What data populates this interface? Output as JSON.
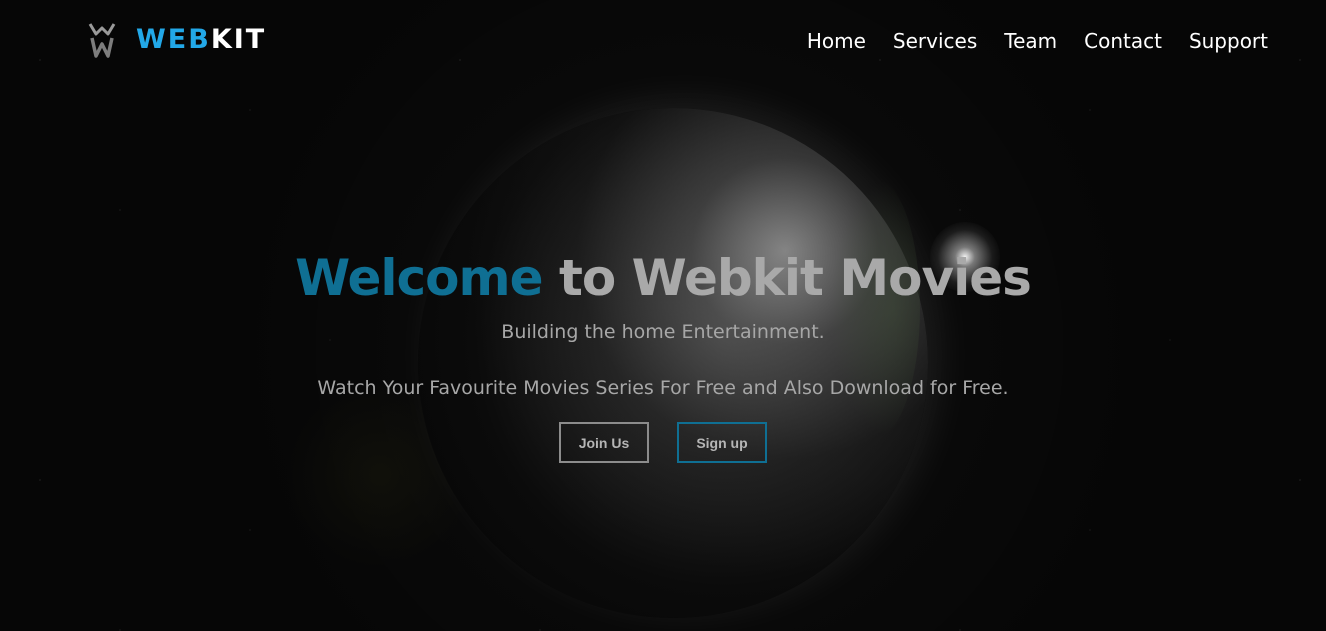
{
  "brand": {
    "part1": "WEB",
    "part2": "KIT",
    "accent_color": "#22a8e8",
    "logo_icon": "webkit-logo-icon"
  },
  "nav": {
    "items": [
      {
        "label": "Home"
      },
      {
        "label": "Services"
      },
      {
        "label": "Team"
      },
      {
        "label": "Contact"
      },
      {
        "label": "Support"
      }
    ]
  },
  "hero": {
    "title_highlight": "Welcome",
    "title_rest": " to Webkit Movies",
    "title_highlight_color": "#0f6f93",
    "subtitle": "Building the home Entertainment.",
    "description": "Watch Your Favourite Movies Series For Free and Also Download for Free.",
    "buttons": {
      "join": "Join Us",
      "signup": "Sign up"
    }
  },
  "background": {
    "theme": "space-earth"
  }
}
